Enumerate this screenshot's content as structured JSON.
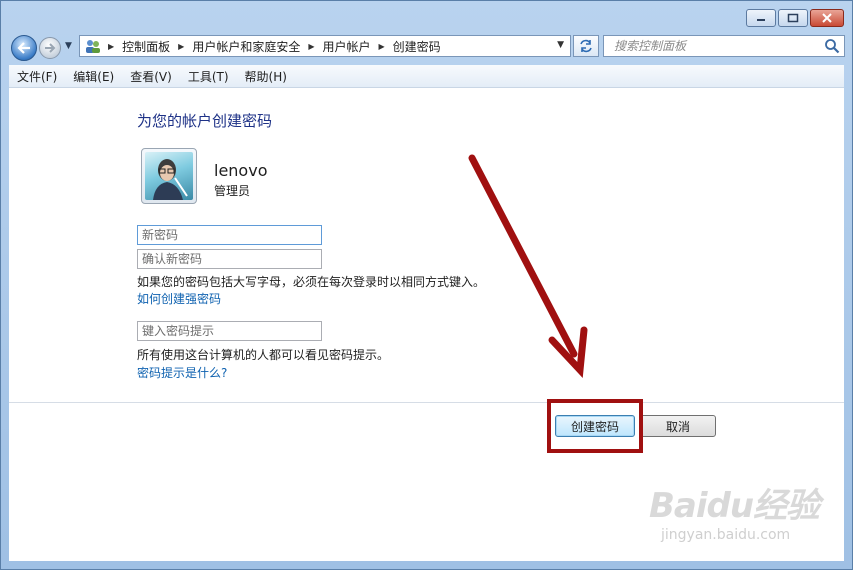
{
  "address_bar": {
    "crumbs": [
      "控制面板",
      "用户帐户和家庭安全",
      "用户帐户",
      "创建密码"
    ]
  },
  "search": {
    "placeholder": "搜索控制面板"
  },
  "menu": [
    "文件(F)",
    "编辑(E)",
    "查看(V)",
    "工具(T)",
    "帮助(H)"
  ],
  "page": {
    "heading": "为您的帐户创建密码",
    "user": {
      "name": "lenovo",
      "role": "管理员"
    },
    "new_password_placeholder": "新密码",
    "confirm_password_placeholder": "确认新密码",
    "caps_note": "如果您的密码包括大写字母，必须在每次登录时以相同方式键入。",
    "strong_password_link": "如何创建强密码",
    "hint_placeholder": "键入密码提示",
    "hint_note": "所有使用这台计算机的人都可以看见密码提示。",
    "hint_link": "密码提示是什么?"
  },
  "buttons": {
    "create": "创建密码",
    "cancel": "取消"
  },
  "annotation": {
    "color": "#a01010"
  },
  "watermark": {
    "brand": "Baidu经验",
    "url": "jingyan.baidu.com"
  }
}
